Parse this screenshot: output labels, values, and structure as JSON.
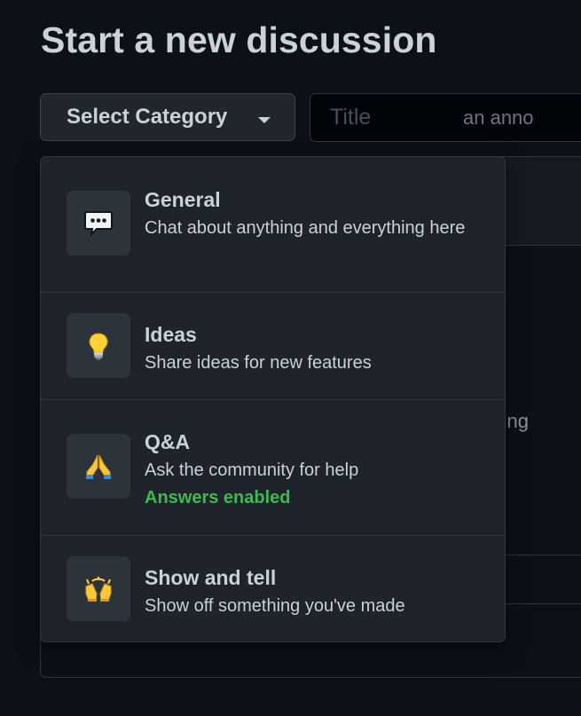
{
  "page": {
    "title": "Start a new discussion"
  },
  "category_button": {
    "label": "Select Category"
  },
  "title_input": {
    "placeholder": "Title"
  },
  "editor": {
    "placeholder_fragment": "an anno",
    "footer_hint_fragment": "pasting"
  },
  "categories": [
    {
      "name": "General",
      "description": "Chat about anything and everything here",
      "icon": "speech-balloon-icon"
    },
    {
      "name": "Ideas",
      "description": "Share ideas for new features",
      "icon": "light-bulb-icon"
    },
    {
      "name": "Q&A",
      "description": "Ask the community for help",
      "tag": "Answers enabled",
      "icon": "folded-hands-icon"
    },
    {
      "name": "Show and tell",
      "description": "Show off something you've made",
      "icon": "raising-hands-icon"
    }
  ],
  "colors": {
    "background": "#0d1117",
    "dropdown": "#1f232b",
    "text": "#c9d1d9",
    "success": "#3fb950",
    "border": "#30363d"
  }
}
